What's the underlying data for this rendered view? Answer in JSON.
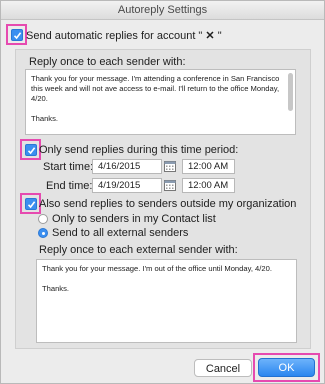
{
  "window": {
    "title": "Autoreply Settings"
  },
  "auto_reply": {
    "checkbox_label": "Send automatic replies for account \"",
    "account_close": "\"",
    "checked": true
  },
  "internal": {
    "heading": "Reply once to each sender with:",
    "message_p1": "Thank you for your message. I'm attending a conference in San Francisco this week and will not ave access to e-mail. I'll return to the office Monday, 4/20.",
    "message_p2": "Thanks."
  },
  "time_period": {
    "checkbox_label": "Only send replies during this time period:",
    "checked": true,
    "start_label": "Start time:",
    "start_date": "4/16/2015",
    "start_time": "12:00 AM",
    "end_label": "End time:",
    "end_date": "4/19/2015",
    "end_time": "12:00 AM"
  },
  "external": {
    "checkbox_label": "Also send replies to senders outside my organization",
    "checked": true,
    "radio_contacts": "Only to senders in my Contact list",
    "radio_all": "Send to all external senders",
    "selected_radio": "all",
    "heading": "Reply once to each external sender with:",
    "message_p1": "Thank you for your message. I'm out of the office until Monday, 4/20.",
    "message_p2": "Thanks."
  },
  "buttons": {
    "cancel": "Cancel",
    "ok": "OK"
  },
  "colors": {
    "accent": "#3b8ff0",
    "highlight": "#e64ab0"
  },
  "icons": {
    "account_close": "x-icon",
    "calendar": "calendar-icon"
  }
}
